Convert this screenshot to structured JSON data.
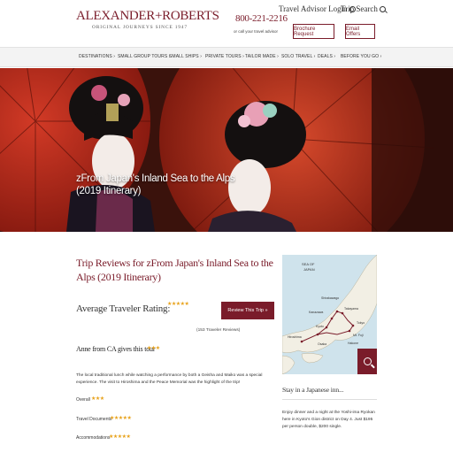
{
  "brand": {
    "logo_text": "ALEXANDER+ROBERTS",
    "tagline": "ORIGINAL JOURNEYS SINCE 1947",
    "color": "#7a1c2a"
  },
  "header": {
    "phone": "800-221-2216",
    "phone_sub": "or call your travel advisor",
    "travel_advisor_login": "Travel Advisor Login",
    "trip_search": "Trip Search",
    "brochure_button": "Brochure Request",
    "email_button": "Email Offers"
  },
  "nav": {
    "items": [
      "DESTINATIONS ›",
      "SMALL GROUP TOURS ›",
      "SMALL SHIPS ›",
      "PRIVATE TOURS ›",
      "TAILOR MADE ›",
      "SOLO TRAVEL ›",
      "DEALS ›",
      "BEFORE YOU GO ›"
    ]
  },
  "hero": {
    "title": "zFrom Japan's Inland Sea to the Alps (2019 Itinerary)"
  },
  "reviews": {
    "title": "Trip Reviews for zFrom Japan's Inland Sea to the Alps (2019 Itinerary)",
    "avg_label": "Average Traveler Rating:",
    "avg_stars": "★★★★★",
    "review_button": "Review This Trip »",
    "count": "(153 Traveler Reviews)",
    "reviewer": "Anne from CA gives this tour",
    "reviewer_stars": "★★★",
    "text": "The local traditional lunch while watching a performance by both a Geisha and Maiko was a special experience. The visit to Hiroshima and the Peace Memorial was the highlight of the trip!",
    "ratings": [
      {
        "label": "Overall",
        "stars": "★★★"
      },
      {
        "label": "Travel Documents",
        "stars": "★★★★★"
      },
      {
        "label": "Accommodations",
        "stars": "★★★★★"
      }
    ]
  },
  "map": {
    "labels": {
      "sea": "SEA OF JAPAN",
      "shirakawago": "Shirakawago",
      "kanazawa": "Kanazawa",
      "takayama": "Takayama",
      "kyoto": "Kyoto",
      "tokyo": "Tokyo",
      "mtfuji": "Mt. Fuji",
      "hakone": "Hakone",
      "osaka": "Osaka",
      "hiroshima": "Hiroshima"
    }
  },
  "sidebar": {
    "title": "Stay in a Japanese inn...",
    "text": "Enjoy dinner and a night at the Yoshi-ima Ryokan here in Kyoto's Gion district on Day 4. Just $195 per person double, $200 single."
  }
}
